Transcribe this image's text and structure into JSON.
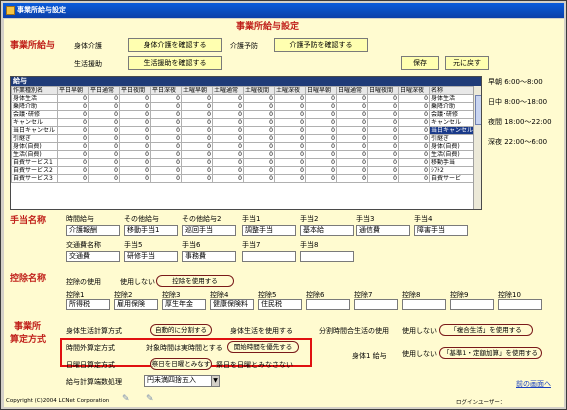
{
  "window": {
    "title": "事業所給与設定"
  },
  "main_title": "事業所給与設定",
  "kyuyo": {
    "heading": "事業所給与",
    "row1_label": "身体介護",
    "row1_btn": "身体介護を確認する",
    "row1b_label": "介護予防",
    "row1b_btn": "介護予防を確認する",
    "row2_label": "生活援助",
    "row2_btn": "生活援助を確認する",
    "save": "保存",
    "revert": "元に戻す"
  },
  "grid": {
    "title": "給与",
    "columns": [
      "作業種別名",
      "平日早朝",
      "平日通常",
      "平日夜間",
      "平日深夜",
      "土曜早朝",
      "土曜通常",
      "土曜夜間",
      "土曜深夜",
      "日曜早朝",
      "日曜通常",
      "日曜夜間",
      "日曜深夜",
      "名称"
    ],
    "rows": [
      [
        "身体生活",
        "0",
        "0",
        "0",
        "0",
        "0",
        "0",
        "0",
        "0",
        "0",
        "0",
        "0",
        "0",
        "身体生活"
      ],
      [
        "乗降介助",
        "0",
        "0",
        "0",
        "0",
        "0",
        "0",
        "0",
        "0",
        "0",
        "0",
        "0",
        "0",
        "乗降介助"
      ],
      [
        "会議･研修",
        "0",
        "0",
        "0",
        "0",
        "0",
        "0",
        "0",
        "0",
        "0",
        "0",
        "0",
        "0",
        "会議･研修"
      ],
      [
        "キャンセル",
        "0",
        "0",
        "0",
        "0",
        "0",
        "0",
        "0",
        "0",
        "0",
        "0",
        "0",
        "0",
        "キャンセル"
      ],
      [
        "当日キャンセル",
        "0",
        "0",
        "0",
        "0",
        "0",
        "0",
        "0",
        "0",
        "0",
        "0",
        "0",
        "0",
        "当日キャンセル"
      ],
      [
        "引継ぎ",
        "0",
        "0",
        "0",
        "0",
        "0",
        "0",
        "0",
        "0",
        "0",
        "0",
        "0",
        "0",
        "引継ぎ"
      ],
      [
        "身体(自費)",
        "0",
        "0",
        "0",
        "0",
        "0",
        "0",
        "0",
        "0",
        "0",
        "0",
        "0",
        "0",
        "身体(自費)"
      ],
      [
        "生活(自費)",
        "0",
        "0",
        "0",
        "0",
        "0",
        "0",
        "0",
        "0",
        "0",
        "0",
        "0",
        "0",
        "生活(自費)"
      ],
      [
        "自費サービス1",
        "0",
        "0",
        "0",
        "0",
        "0",
        "0",
        "0",
        "0",
        "0",
        "0",
        "0",
        "0",
        "移動手当"
      ],
      [
        "自費サービス2",
        "0",
        "0",
        "0",
        "0",
        "0",
        "0",
        "0",
        "0",
        "0",
        "0",
        "0",
        "0",
        "ｼﾌﾄ2"
      ],
      [
        "自費サービス3",
        "0",
        "0",
        "0",
        "0",
        "0",
        "0",
        "0",
        "0",
        "0",
        "0",
        "0",
        "0",
        "自費サービ"
      ]
    ]
  },
  "timebands": [
    "早朝 6:00～8:00",
    "日中 8:00～18:00",
    "夜間 18:00～22:00",
    "深夜 22:00～6:00"
  ],
  "teate": {
    "heading": "手当名称",
    "row1_labels": [
      "時間給与",
      "その他給与",
      "その他給与2",
      "手当1",
      "手当2",
      "手当3",
      "手当4"
    ],
    "row1_values": [
      "介護報酬",
      "移動手当1",
      "巡回手当",
      "調整手当",
      "基本給",
      "通信費",
      "障害手当"
    ],
    "row2_labels": [
      "交通費名称",
      "手当5",
      "手当6",
      "手当7",
      "手当8"
    ],
    "row2_values": [
      "交通費",
      "研修手当",
      "事務費",
      "",
      ""
    ]
  },
  "kojo": {
    "heading": "控除名称",
    "use_label": "控除の使用",
    "not_use": "使用しない",
    "use_btn": "控除を使用する",
    "labels": [
      "控除1",
      "控除2",
      "控除3",
      "控除4",
      "控除5",
      "控除6",
      "控除7",
      "控除8",
      "控除9",
      "控除10"
    ],
    "values": [
      "所得税",
      "雇用保険",
      "厚生年金",
      "健康保険料",
      "住民税",
      "",
      "",
      "",
      "",
      ""
    ]
  },
  "santei": {
    "heading1": "事業所",
    "heading2": "算定方式",
    "calc_label": "身体生活計算方式",
    "calc_opt1": "自動的に分割する",
    "calc_opt2": "身体生活を使用する",
    "bunkatsu_label": "分割時間合生活の使用",
    "bunkatsu_not": "使用しない",
    "bunkatsu_use": "「複合生活」を使用する",
    "jikangai_label": "時間外算定方式",
    "jikangai_opt1": "対象時間は実時間とする",
    "jikangai_opt2": "開始時間を優先する",
    "shintai1_label": "身体1 給与",
    "shintai1_not": "使用しない",
    "shintai1_use": "「基準1・定額加算」を使用する",
    "nichiyo_label": "日曜日算定方式",
    "nichiyo_opt1": "祭日を日曜とみなす",
    "nichiyo_opt2": "祭日を日曜とみなさない",
    "rounding_label": "給与計算端数処理",
    "rounding_value": "円未満四捨五入"
  },
  "footer": {
    "copyright": "Copyright (C)2004 LCNet Corporation",
    "login": "ログインユーザー：",
    "back": "前の画面へ"
  },
  "colors": {
    "accent_red": "#c0201a",
    "title_blue": "#0b3fa8",
    "panel_bg": "#fffbd0",
    "highlight_box": "#e01010"
  }
}
